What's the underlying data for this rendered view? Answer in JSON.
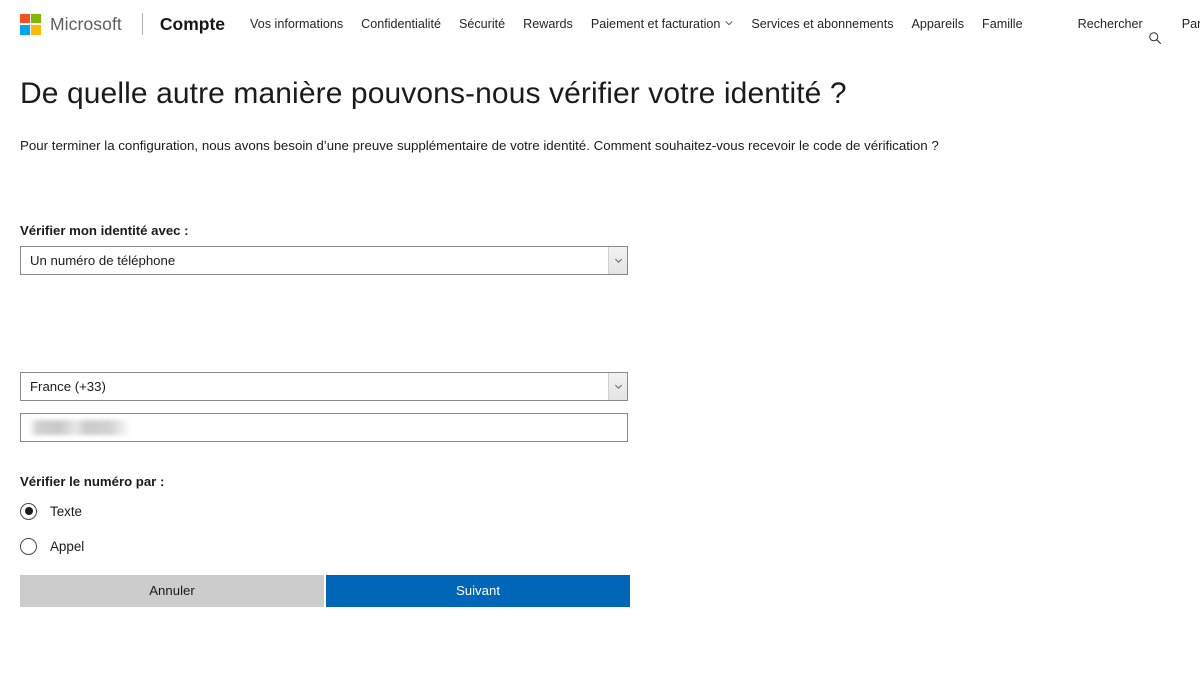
{
  "header": {
    "logo_name": "microsoft-logo",
    "wordmark": "Microsoft",
    "brand": "Compte",
    "nav": [
      {
        "label": "Vos informations",
        "has_chevron": false
      },
      {
        "label": "Confidentialité",
        "has_chevron": false
      },
      {
        "label": "Sécurité",
        "has_chevron": false
      },
      {
        "label": "Rewards",
        "has_chevron": false
      },
      {
        "label": "Paiement et facturation",
        "has_chevron": true
      },
      {
        "label": "Services et abonnements",
        "has_chevron": false
      },
      {
        "label": "Appareils",
        "has_chevron": false
      },
      {
        "label": "Famille",
        "has_chevron": false
      }
    ],
    "search_label": "Rechercher",
    "search_icon": "search-icon",
    "cart_label": "Panier"
  },
  "main": {
    "title": "De quelle autre manière pouvons-nous vérifier votre identité ?",
    "subtitle": "Pour terminer la configuration, nous avons besoin d’une preuve supplémentaire de votre identité. Comment souhaitez-vous recevoir le code de vérification ?",
    "method": {
      "label": "Vérifier mon identité avec :",
      "selected": "Un numéro de téléphone",
      "options": [
        "Un numéro de téléphone"
      ]
    },
    "country": {
      "selected": "France (+33)",
      "options": [
        "France (+33)"
      ]
    },
    "phone": {
      "value": "",
      "placeholder": "",
      "redacted": true
    },
    "verify_by": {
      "label": "Vérifier le numéro par :",
      "options": [
        {
          "label": "Texte",
          "checked": true
        },
        {
          "label": "Appel",
          "checked": false
        }
      ]
    },
    "buttons": {
      "cancel": "Annuler",
      "next": "Suivant"
    }
  },
  "colors": {
    "accent_blue": "#0067b8",
    "cancel_gray": "#cccccc",
    "logo_red": "#f25022",
    "logo_green": "#7fba00",
    "logo_blue": "#00a4ef",
    "logo_yellow": "#ffb900"
  }
}
